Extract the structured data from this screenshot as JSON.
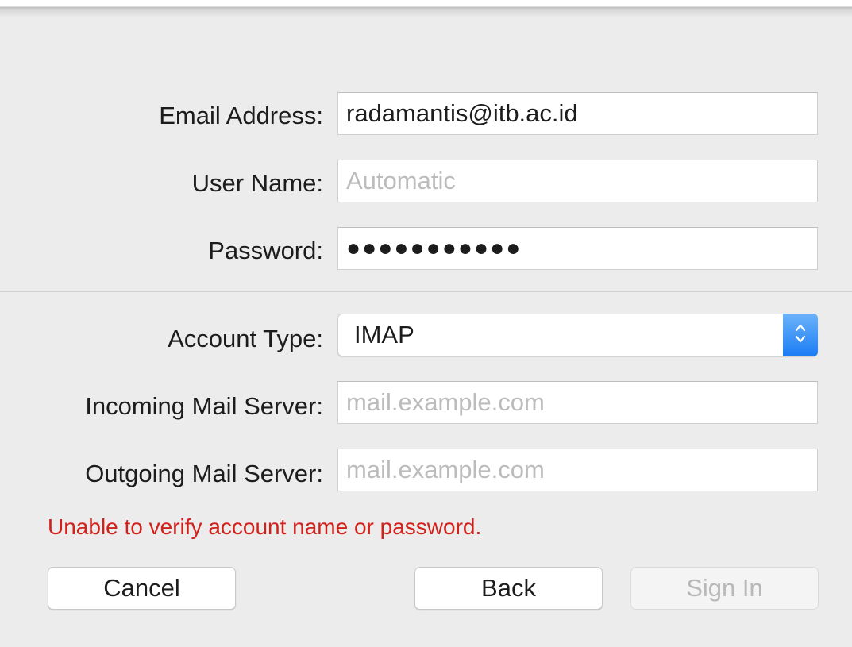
{
  "form": {
    "email_label": "Email Address:",
    "email_value": "radamantis@itb.ac.id",
    "username_label": "User Name:",
    "username_placeholder": "Automatic",
    "password_label": "Password:",
    "password_dots": "●●●●●●●●●●●",
    "account_type_label": "Account Type:",
    "account_type_value": "IMAP",
    "incoming_label": "Incoming Mail Server:",
    "incoming_placeholder": "mail.example.com",
    "outgoing_label": "Outgoing Mail Server:",
    "outgoing_placeholder": "mail.example.com"
  },
  "error_message": "Unable to verify account name or password.",
  "buttons": {
    "cancel": "Cancel",
    "back": "Back",
    "sign_in": "Sign In"
  },
  "icons": {
    "stepper": "up-down-chevron-icon"
  },
  "colors": {
    "error": "#d0211a",
    "accent": "#1a7cf5"
  }
}
